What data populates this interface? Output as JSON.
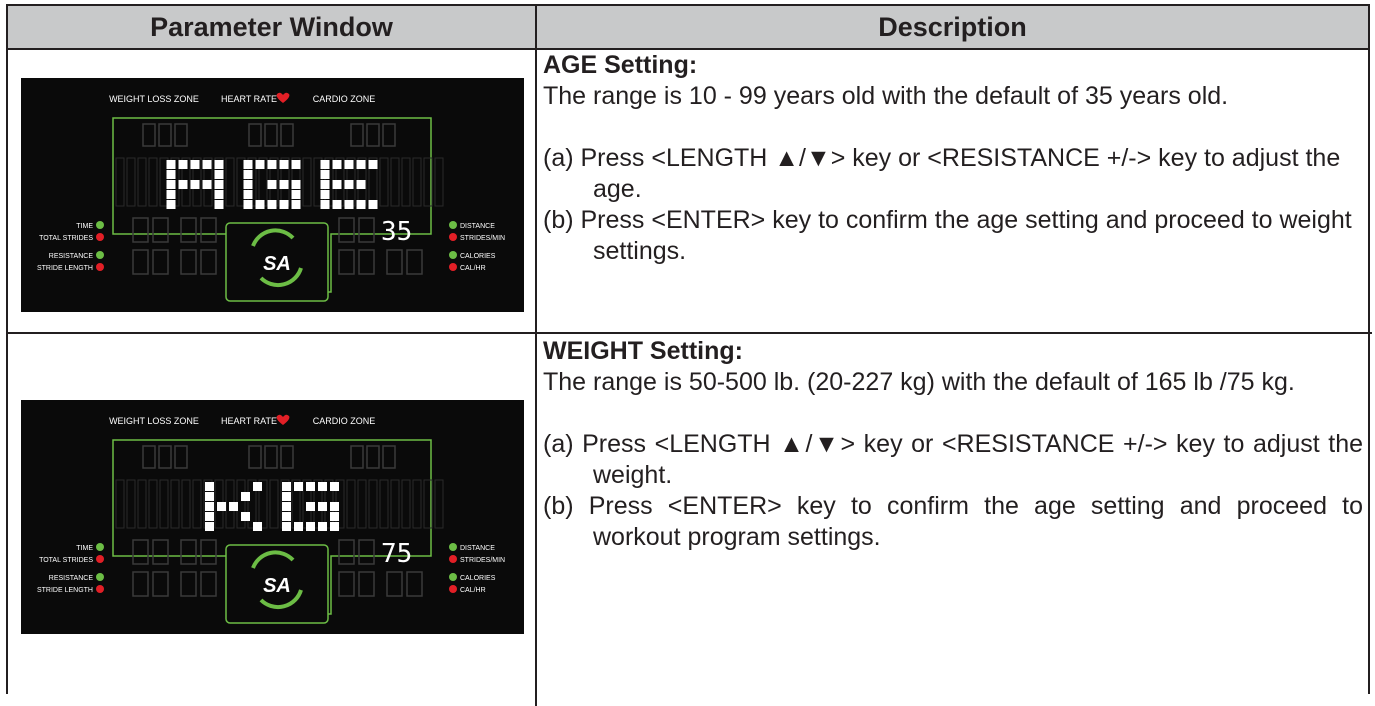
{
  "header": {
    "col1": "Parameter Window",
    "col2": "Description"
  },
  "rows": [
    {
      "display": {
        "top_labels": [
          "WEIGHT LOSS ZONE",
          "HEART RATE",
          "CARDIO ZONE"
        ],
        "left_labels": [
          "TIME",
          "TOTAL STRIDES",
          "RESISTANCE",
          "STRIDE LENGTH"
        ],
        "right_labels": [
          "DISTANCE",
          "STRIDES/MIN",
          "CALORIES",
          "CAL/HR"
        ],
        "big_text": "AGE",
        "value": "35",
        "logo": "SA"
      },
      "title": "AGE Setting:",
      "range": "The range is 10 - 99 years old with the default of 35 years old.",
      "items": [
        "(a) Press <LENGTH ▲/▼> key or <RESISTANCE +/-> key to adjust the age.",
        "(b) Press <ENTER> key to confirm the age setting and proceed to weight settings."
      ]
    },
    {
      "display": {
        "top_labels": [
          "WEIGHT LOSS ZONE",
          "HEART RATE",
          "CARDIO ZONE"
        ],
        "left_labels": [
          "TIME",
          "TOTAL STRIDES",
          "RESISTANCE",
          "STRIDE LENGTH"
        ],
        "right_labels": [
          "DISTANCE",
          "STRIDES/MIN",
          "CALORIES",
          "CAL/HR"
        ],
        "big_text": "KG",
        "value": "75",
        "logo": "SA"
      },
      "title": "WEIGHT Setting:",
      "range": "The range is 50-500 lb. (20-227 kg) with the default of 165 lb /75 kg.",
      "items": [
        "(a) Press <LENGTH ▲/▼> key or <RESISTANCE +/-> key to adjust the weight.",
        "(b) Press <ENTER> key to confirm the age setting and proceed to workout program settings."
      ]
    }
  ],
  "colors": {
    "panel_bg": "#0a0a0a",
    "green": "#6cbd45",
    "red": "#e21f26",
    "header_bg": "#c8c9ca",
    "segment_dim": "#3a3a3a"
  }
}
